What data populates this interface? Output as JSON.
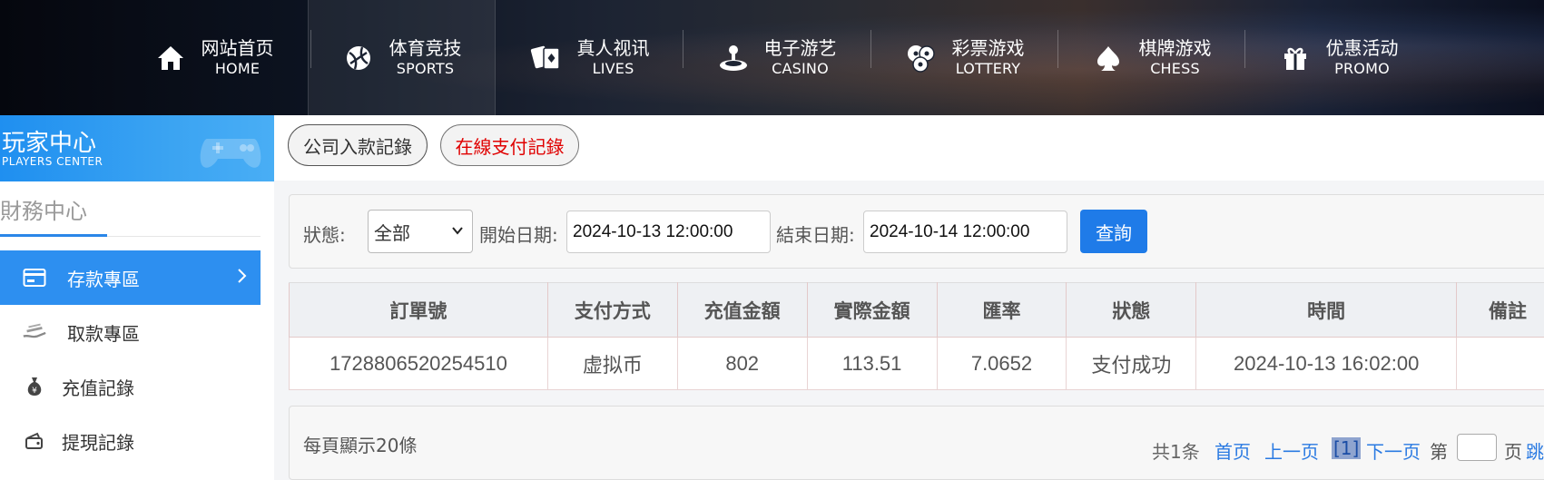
{
  "nav": {
    "items": [
      {
        "cn": "网站首页",
        "en": "HOME",
        "icon": "home-icon"
      },
      {
        "cn": "体育竞技",
        "en": "SPORTS",
        "icon": "ball-icon"
      },
      {
        "cn": "真人视讯",
        "en": "LIVES",
        "icon": "cards-icon"
      },
      {
        "cn": "电子游艺",
        "en": "CASINO",
        "icon": "joystick-icon"
      },
      {
        "cn": "彩票游戏",
        "en": "LOTTERY",
        "icon": "lottery-balls-icon"
      },
      {
        "cn": "棋牌游戏",
        "en": "CHESS",
        "icon": "spade-icon"
      },
      {
        "cn": "优惠活动",
        "en": "PROMO",
        "icon": "gift-icon"
      }
    ],
    "active": "SPORTS"
  },
  "sidebar": {
    "banner_cn": "玩家中心",
    "banner_en": "PLAYERS CENTER",
    "section_title": "財務中心",
    "menu": [
      {
        "label": "存款專區",
        "icon": "card-icon",
        "active": true
      },
      {
        "label": "取款專區",
        "icon": "hand-coin-icon",
        "active": false
      },
      {
        "label": "充值記錄",
        "icon": "money-bag-icon",
        "active": false
      },
      {
        "label": "提現記錄",
        "icon": "wallet-icon",
        "active": false
      }
    ]
  },
  "tabs": {
    "company": "公司入款記錄",
    "online": "在線支付記錄"
  },
  "filter": {
    "status_label": "狀態:",
    "status_value": "全部",
    "start_label": "開始日期:",
    "start_value": "2024-10-13 12:00:00",
    "end_label": "結束日期:",
    "end_value": "2024-10-14 12:00:00",
    "query_button": "查詢"
  },
  "table": {
    "headers": [
      "訂單號",
      "支付方式",
      "充值金額",
      "實際金額",
      "匯率",
      "狀態",
      "時間",
      "備註"
    ],
    "rows": [
      [
        "1728806520254510",
        "虚拟币",
        "802",
        "113.51",
        "7.0652",
        "支付成功",
        "2024-10-13 16:02:00",
        ""
      ]
    ]
  },
  "pager": {
    "per_page": "每頁顯示20條",
    "total": "共1条",
    "first": "首页",
    "prev": "上一页",
    "current": "[1]",
    "next": "下一页",
    "di": "第",
    "ye": "页",
    "jump": "跳"
  },
  "colors": {
    "accent": "#2d8ff0",
    "query_button": "#1f7be8",
    "online_tab_text": "#e00000"
  }
}
